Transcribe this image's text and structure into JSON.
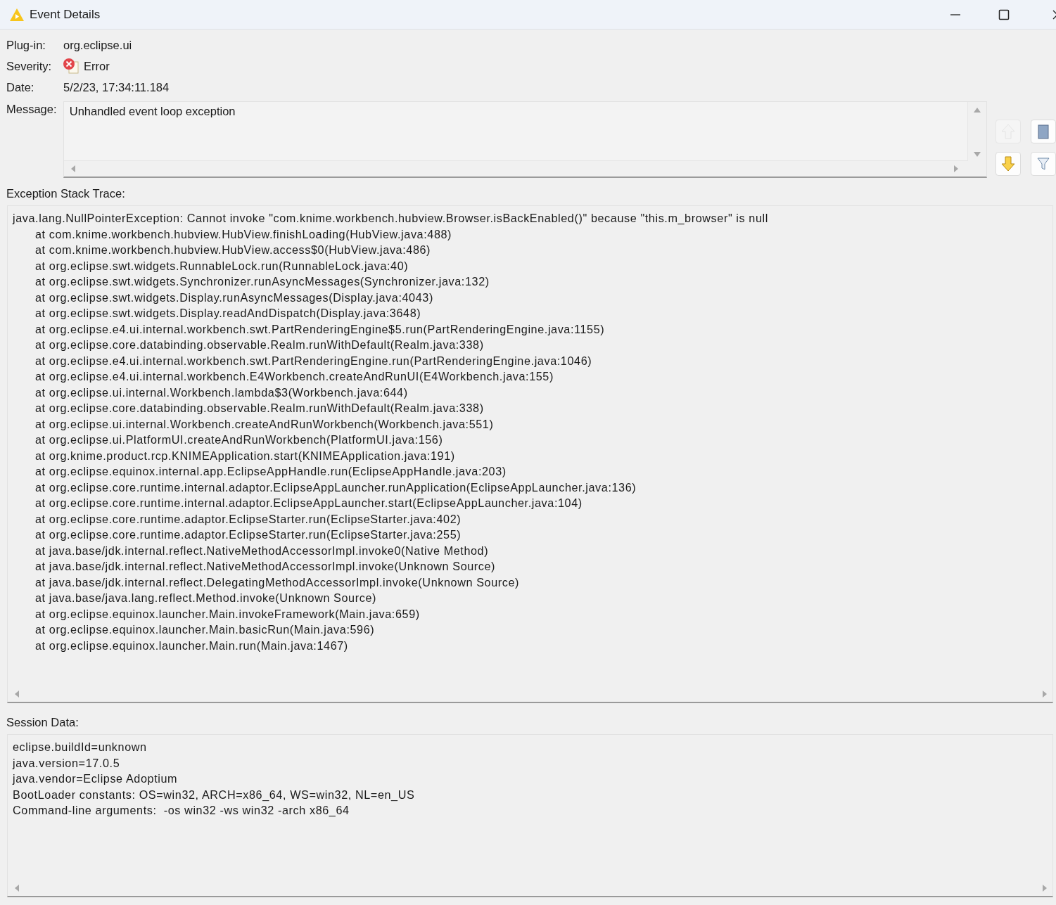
{
  "window": {
    "title": "Event Details"
  },
  "details": [
    {
      "kind": "text",
      "label": "Plug-in:",
      "value": "org.eclipse.ui"
    },
    {
      "kind": "severity",
      "label": "Severity:",
      "value": "Error"
    },
    {
      "kind": "text",
      "label": "Date:",
      "value": "5/2/23, 17:34:11.184"
    }
  ],
  "message": {
    "label": "Message:",
    "value": "Unhandled event loop exception"
  },
  "side_buttons": [
    {
      "kind": "up",
      "disabled": true
    },
    {
      "kind": "copy",
      "disabled": false
    },
    {
      "kind": "down",
      "disabled": false
    },
    {
      "kind": "filter",
      "disabled": false
    }
  ],
  "stack_trace": {
    "label": "Exception Stack Trace:",
    "exception": "java.lang.NullPointerException: Cannot invoke \"com.knime.workbench.hubview.Browser.isBackEnabled()\" because \"this.m_browser\" is null",
    "frames": [
      "at com.knime.workbench.hubview.HubView.finishLoading(HubView.java:488)",
      "at com.knime.workbench.hubview.HubView.access$0(HubView.java:486)",
      "at org.eclipse.swt.widgets.RunnableLock.run(RunnableLock.java:40)",
      "at org.eclipse.swt.widgets.Synchronizer.runAsyncMessages(Synchronizer.java:132)",
      "at org.eclipse.swt.widgets.Display.runAsyncMessages(Display.java:4043)",
      "at org.eclipse.swt.widgets.Display.readAndDispatch(Display.java:3648)",
      "at org.eclipse.e4.ui.internal.workbench.swt.PartRenderingEngine$5.run(PartRenderingEngine.java:1155)",
      "at org.eclipse.core.databinding.observable.Realm.runWithDefault(Realm.java:338)",
      "at org.eclipse.e4.ui.internal.workbench.swt.PartRenderingEngine.run(PartRenderingEngine.java:1046)",
      "at org.eclipse.e4.ui.internal.workbench.E4Workbench.createAndRunUI(E4Workbench.java:155)",
      "at org.eclipse.ui.internal.Workbench.lambda$3(Workbench.java:644)",
      "at org.eclipse.core.databinding.observable.Realm.runWithDefault(Realm.java:338)",
      "at org.eclipse.ui.internal.Workbench.createAndRunWorkbench(Workbench.java:551)",
      "at org.eclipse.ui.PlatformUI.createAndRunWorkbench(PlatformUI.java:156)",
      "at org.knime.product.rcp.KNIMEApplication.start(KNIMEApplication.java:191)",
      "at org.eclipse.equinox.internal.app.EclipseAppHandle.run(EclipseAppHandle.java:203)",
      "at org.eclipse.core.runtime.internal.adaptor.EclipseAppLauncher.runApplication(EclipseAppLauncher.java:136)",
      "at org.eclipse.core.runtime.internal.adaptor.EclipseAppLauncher.start(EclipseAppLauncher.java:104)",
      "at org.eclipse.core.runtime.adaptor.EclipseStarter.run(EclipseStarter.java:402)",
      "at org.eclipse.core.runtime.adaptor.EclipseStarter.run(EclipseStarter.java:255)",
      "at java.base/jdk.internal.reflect.NativeMethodAccessorImpl.invoke0(Native Method)",
      "at java.base/jdk.internal.reflect.NativeMethodAccessorImpl.invoke(Unknown Source)",
      "at java.base/jdk.internal.reflect.DelegatingMethodAccessorImpl.invoke(Unknown Source)",
      "at java.base/java.lang.reflect.Method.invoke(Unknown Source)",
      "at org.eclipse.equinox.launcher.Main.invokeFramework(Main.java:659)",
      "at org.eclipse.equinox.launcher.Main.basicRun(Main.java:596)",
      "at org.eclipse.equinox.launcher.Main.run(Main.java:1467)"
    ]
  },
  "session_data": {
    "label": "Session Data:",
    "lines": [
      "eclipse.buildId=unknown",
      "java.version=17.0.5",
      "java.vendor=Eclipse Adoptium",
      "BootLoader constants: OS=win32, ARCH=x86_64, WS=win32, NL=en_US",
      "Command-line arguments:  -os win32 -ws win32 -arch x86_64"
    ]
  }
}
